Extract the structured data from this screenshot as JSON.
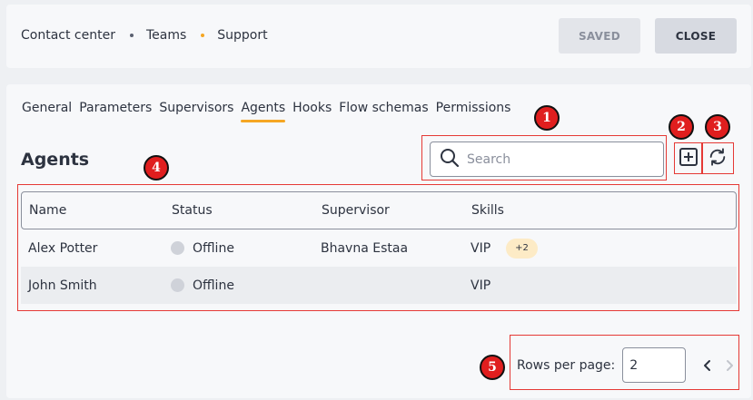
{
  "header": {
    "breadcrumb": [
      "Contact center",
      "Teams",
      "Support"
    ],
    "saved_label": "SAVED",
    "close_label": "CLOSE"
  },
  "tabs": [
    {
      "label": "General",
      "active": false
    },
    {
      "label": "Parameters",
      "active": false
    },
    {
      "label": "Supervisors",
      "active": false
    },
    {
      "label": "Agents",
      "active": true
    },
    {
      "label": "Hooks",
      "active": false
    },
    {
      "label": "Flow schemas",
      "active": false
    },
    {
      "label": "Permissions",
      "active": false
    }
  ],
  "section": {
    "title": "Agents",
    "search_placeholder": "Search"
  },
  "table": {
    "columns": [
      "Name",
      "Status",
      "Supervisor",
      "Skills"
    ],
    "rows": [
      {
        "name": "Alex Potter",
        "status": "Offline",
        "supervisor": "Bhavna Estaa",
        "skill": "VIP",
        "extra": "+2"
      },
      {
        "name": "John Smith",
        "status": "Offline",
        "supervisor": "",
        "skill": "VIP",
        "extra": ""
      }
    ]
  },
  "pagination": {
    "label": "Rows per page:",
    "value": "2"
  },
  "annotations": [
    "1",
    "2",
    "3",
    "4",
    "5"
  ],
  "colors": {
    "accent": "#f5a623",
    "annotation": "#e01e1e",
    "status_offline": "#cfd2d9",
    "badge_bg": "#fdebc6"
  },
  "icons": [
    "search-icon",
    "add-icon",
    "refresh-icon",
    "chevron-left-icon",
    "chevron-right-icon"
  ]
}
